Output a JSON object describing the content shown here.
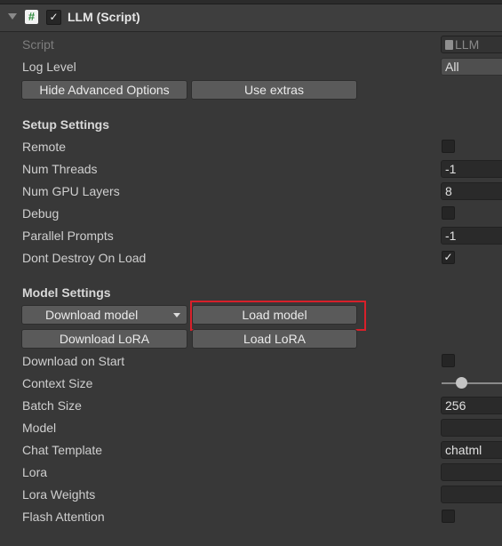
{
  "component": {
    "title": "LLM (Script)",
    "enabled": true,
    "icon": "script-icon"
  },
  "fields": {
    "script_label": "Script",
    "script_value": "LLM",
    "log_level_label": "Log Level",
    "log_level_value": "All"
  },
  "buttons": {
    "hide_advanced": "Hide Advanced Options",
    "use_extras": "Use extras"
  },
  "setup": {
    "title": "Setup Settings",
    "remote_label": "Remote",
    "remote_checked": false,
    "num_threads_label": "Num Threads",
    "num_threads_value": "-1",
    "num_gpu_layers_label": "Num GPU Layers",
    "num_gpu_layers_value": "8",
    "debug_label": "Debug",
    "debug_checked": false,
    "parallel_prompts_label": "Parallel Prompts",
    "parallel_prompts_value": "-1",
    "dont_destroy_label": "Dont Destroy On Load",
    "dont_destroy_checked": true
  },
  "model": {
    "title": "Model Settings",
    "download_model": "Download model",
    "load_model": "Load model",
    "download_lora": "Download LoRA",
    "load_lora": "Load LoRA",
    "download_on_start_label": "Download on Start",
    "download_on_start_checked": false,
    "context_size_label": "Context Size",
    "batch_size_label": "Batch Size",
    "batch_size_value": "256",
    "model_label": "Model",
    "model_value": "",
    "chat_template_label": "Chat Template",
    "chat_template_value": "chatml",
    "lora_label": "Lora",
    "lora_value": "",
    "lora_weights_label": "Lora Weights",
    "lora_weights_value": "",
    "flash_attention_label": "Flash Attention",
    "flash_attention_checked": false
  },
  "check_glyph": "✓",
  "highlight_color": "#d8202a"
}
